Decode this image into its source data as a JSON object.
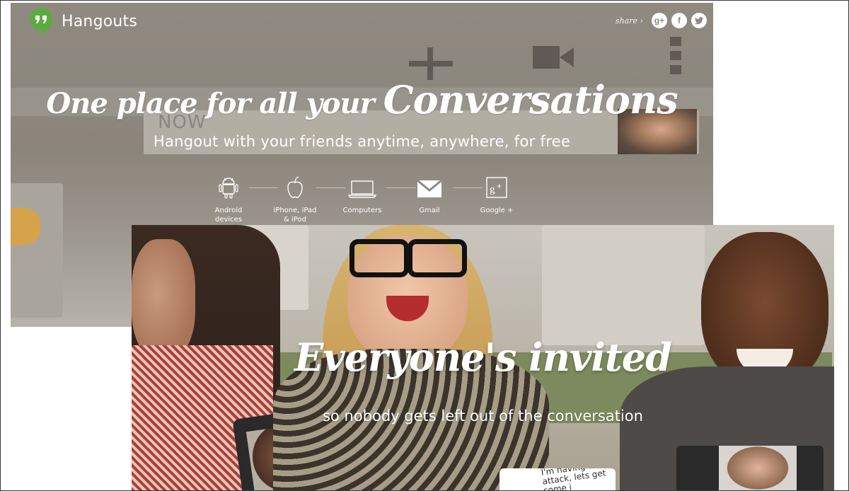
{
  "app": {
    "name": "Hangouts",
    "share_label": "share ›",
    "share_buttons": [
      {
        "id": "google-plus",
        "glyph": "g+"
      },
      {
        "id": "facebook",
        "glyph": "f"
      },
      {
        "id": "twitter",
        "glyph": "twitter-bird"
      }
    ]
  },
  "hero": {
    "title_part1": "One place for all your",
    "title_part2": "Conversations",
    "subtitle": "Hangout with your friends anytime, anywhere, for free",
    "background_ui": {
      "now_label": "NOW",
      "icons": [
        "plus-icon",
        "video-camera-icon",
        "overflow-menu-icon"
      ]
    }
  },
  "platforms": [
    {
      "icon": "android-icon",
      "label": "Android devices",
      "line1": "Android",
      "line2": "devices"
    },
    {
      "icon": "apple-icon",
      "label": "iPhone, iPad & iPod",
      "line1": "iPhone, iPad",
      "line2": "& iPod"
    },
    {
      "icon": "laptop-icon",
      "label": "Computers",
      "line1": "Computers",
      "line2": ""
    },
    {
      "icon": "gmail-icon",
      "label": "Gmail",
      "line1": "Gmail",
      "line2": ""
    },
    {
      "icon": "google-plus-icon",
      "label": "Google +",
      "line1": "Google +",
      "line2": ""
    }
  ],
  "invite": {
    "title": "Everyone's invited",
    "subtitle": "so nobody gets left out of the conversation",
    "chat_snippet": "I'm having a snack attack, lets get some i"
  },
  "colors": {
    "brand_green": "#5bab3f",
    "hero_overlay": "#8f8a80",
    "text_white": "#ffffff"
  }
}
